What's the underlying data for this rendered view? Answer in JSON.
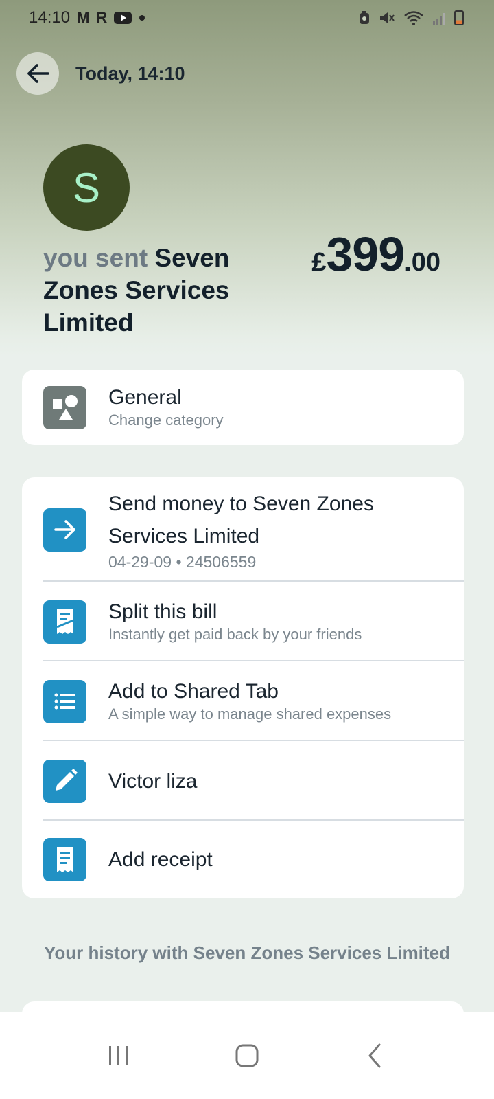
{
  "status_bar": {
    "time": "14:10",
    "left_glyphs": [
      "M",
      "R"
    ],
    "left_icons": [
      "m-icon",
      "r-icon",
      "youtube-icon",
      "dot-icon"
    ],
    "right_icons": [
      "alarm-icon",
      "mute-icon",
      "wifi-icon",
      "signal-icon",
      "battery-icon"
    ]
  },
  "header": {
    "title": "Today, 14:10",
    "back_icon": "arrow-left-icon"
  },
  "merchant": {
    "initial": "S",
    "prefix": "you sent",
    "name": "Seven Zones Services Limited",
    "avatar_color": "#3c4a22",
    "initial_color": "#a8f0c8"
  },
  "amount": {
    "currency": "£",
    "whole": "399",
    "decimal": ".00"
  },
  "category": {
    "title": "General",
    "subtitle": "Change category",
    "icon": "shapes-icon"
  },
  "actions": [
    {
      "title": "Send money to Seven Zones Services Limited",
      "subtitle": "04-29-09 • 24506559",
      "icon": "arrow-right-icon"
    },
    {
      "title": "Split this bill",
      "subtitle": "Instantly get paid back by your friends",
      "icon": "split-bill-icon"
    },
    {
      "title": "Add to Shared Tab",
      "subtitle": "A simple way to manage shared expenses",
      "icon": "list-icon"
    },
    {
      "title": "Victor liza",
      "subtitle": "",
      "icon": "pencil-icon"
    },
    {
      "title": "Add receipt",
      "subtitle": "",
      "icon": "receipt-icon"
    }
  ],
  "history": {
    "title": "Your history with Seven Zones Services Limited"
  },
  "navbar": {
    "icons": [
      "recent-apps-icon",
      "home-icon",
      "back-icon"
    ]
  },
  "colors": {
    "accent": "#2191c4",
    "category_icon": "#6f7a78",
    "text_primary": "#13202b",
    "text_muted": "#7b868e"
  }
}
